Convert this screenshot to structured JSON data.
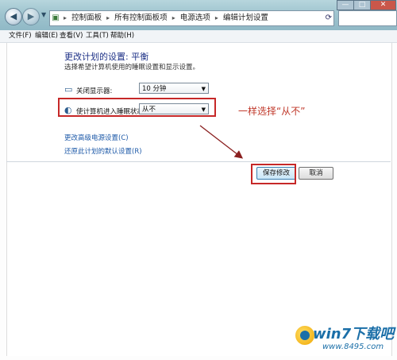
{
  "window": {
    "address_icon": "control-panel-icon",
    "breadcrumbs": [
      "控制面板",
      "所有控制面板项",
      "电源选项",
      "编辑计划设置"
    ],
    "controls": {
      "minimize": "—",
      "maximize": "□",
      "close": "✕"
    }
  },
  "menu": {
    "items": [
      "文件(F)",
      "编辑(E)",
      "查看(V)",
      "工具(T)",
      "帮助(H)"
    ]
  },
  "page": {
    "title": "更改计划的设置: 平衡",
    "subtitle": "选择希望计算机使用的睡眠设置和显示设置。",
    "rows": [
      {
        "icon": "monitor-icon",
        "label": "关闭显示器:",
        "value": "10 分钟"
      },
      {
        "icon": "moon-icon",
        "label": "使计算机进入睡眠状态:",
        "value": "从不"
      }
    ],
    "links": [
      "更改高级电源设置(C)",
      "还原此计划的默认设置(R)"
    ]
  },
  "buttons": {
    "save": "保存修改",
    "cancel": "取消"
  },
  "annotation": {
    "text": "一样选择“从不”",
    "color": "#c0392b"
  },
  "watermark": {
    "main": "win7下载吧",
    "sub": "www.8495.com"
  },
  "colors": {
    "title": "#1e3287",
    "link": "#1e5aa8",
    "highlight_box": "#c62828"
  }
}
